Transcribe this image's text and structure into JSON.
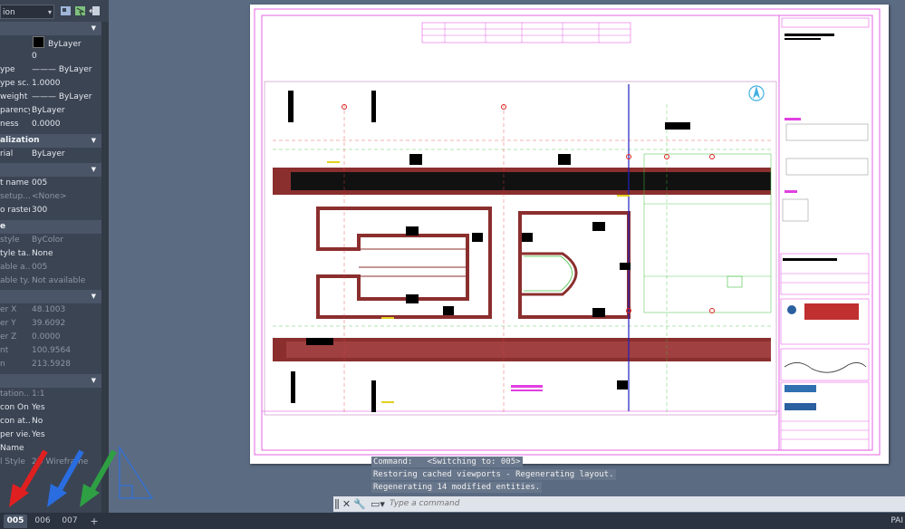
{
  "palette": {
    "combo_value": "ion",
    "rows_general": [
      {
        "name": "",
        "value": "ByLayer",
        "swatch": "#000000"
      },
      {
        "name": "",
        "value": "0"
      },
      {
        "name": "ype",
        "value": "——— ByLayer"
      },
      {
        "name": "ype sc...",
        "value": "1.0000"
      },
      {
        "name": "weight",
        "value": "——— ByLayer"
      },
      {
        "name": "parency",
        "value": "ByLayer"
      },
      {
        "name": "ness",
        "value": "0.0000"
      }
    ],
    "section_visualization": "alization",
    "rows_vis": [
      {
        "name": "rial",
        "value": "ByLayer"
      }
    ],
    "rows_plot": [
      {
        "name": "t name",
        "value": "005"
      },
      {
        "name": "setup...",
        "value": "<None>"
      },
      {
        "name": "o raster",
        "value": "300"
      }
    ],
    "section_e": "e",
    "rows_style": [
      {
        "name": "style",
        "value": "ByColor"
      },
      {
        "name": "tyle ta...",
        "value": "None"
      },
      {
        "name": "able a...",
        "value": "005"
      },
      {
        "name": "able ty...",
        "value": "Not available"
      }
    ],
    "rows_geom": [
      {
        "name": "er X",
        "value": "48.1003"
      },
      {
        "name": "er Y",
        "value": "39.6092"
      },
      {
        "name": "er Z",
        "value": "0.0000"
      },
      {
        "name": "nt",
        "value": "100.9564"
      },
      {
        "name": "n",
        "value": "213.5928"
      }
    ],
    "rows_misc": [
      {
        "name": "tation...",
        "value": "1:1"
      },
      {
        "name": "con On",
        "value": "Yes"
      },
      {
        "name": "con at...",
        "value": "No"
      },
      {
        "name": "per vie...",
        "value": "Yes"
      },
      {
        "name": "Name",
        "value": ""
      },
      {
        "name": "l Style",
        "value": "2D Wireframe"
      }
    ]
  },
  "command": {
    "history": [
      "Command:   <Switching to: 005>",
      "Restoring cached viewports - Regenerating layout.",
      "Regenerating 14 modified entities."
    ],
    "placeholder": "Type a command"
  },
  "tabs": [
    "005",
    "006",
    "007",
    "+"
  ],
  "status_right": "PAI",
  "colors": {
    "background": "#5b6b82",
    "palette_bg": "#3b4453",
    "drawing_magenta": "#e040e0",
    "drawing_red": "#8b2e2e",
    "annotation_red": "#e02020",
    "annotation_blue": "#2a6de0",
    "annotation_green": "#2ea043"
  }
}
